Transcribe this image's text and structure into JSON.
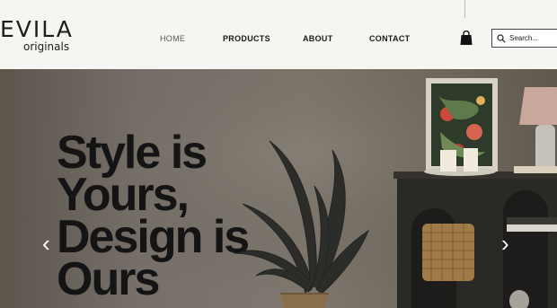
{
  "brand": {
    "name": "EVILA",
    "tagline": "originals"
  },
  "nav": {
    "items": [
      "HOME",
      "PRODUCTS",
      "ABOUT",
      "CONTACT"
    ],
    "active": "HOME"
  },
  "search": {
    "placeholder": "Search..."
  },
  "hero": {
    "headline": "Style is Yours, Design is Ours"
  },
  "icons": {
    "cart": "shopping-bag-icon",
    "search": "search-icon",
    "prev": "chevron-left-icon",
    "next": "chevron-right-icon"
  },
  "colors": {
    "background": "#f6f5f1",
    "text": "#1a1a1a"
  }
}
